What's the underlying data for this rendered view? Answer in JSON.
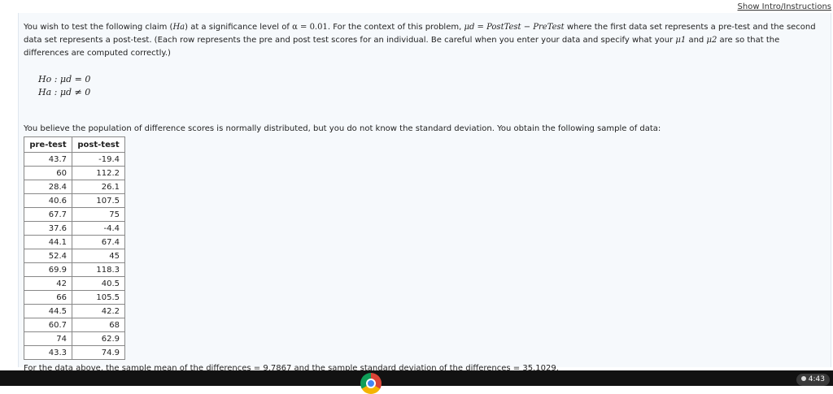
{
  "header": {
    "instructions_link": "Show Intro/Instructions"
  },
  "problem": {
    "sentence1_a": "You wish to test the following claim (",
    "sentence1_ha": "Ha",
    "sentence1_b": ") at a significance level of",
    "alpha_expr": "α = 0.01",
    "sentence1_c": ". For the context of this problem,",
    "mud_expr": "μd = PostTest − PreTest",
    "sentence1_d": "where the first data set represents a pre-test and the second data set represents a post-test. (Each row represents the pre and post test scores for an individual. Be careful when you enter your data and specify what your",
    "mu1": "μ1",
    "and_word": "and",
    "mu2": "μ2",
    "sentence1_e": "are so that the differences are computed correctly.)"
  },
  "hypotheses": {
    "h0": "Ho : μd = 0",
    "ha": "Ha : μd ≠ 0"
  },
  "believe_text": "You believe the population of difference scores is normally distributed, but you do not know the standard deviation. You obtain the following sample of data:",
  "table": {
    "headers": [
      "pre-test",
      "post-test"
    ],
    "rows": [
      [
        "43.7",
        "-19.4"
      ],
      [
        "60",
        "112.2"
      ],
      [
        "28.4",
        "26.1"
      ],
      [
        "40.6",
        "107.5"
      ],
      [
        "67.7",
        "75"
      ],
      [
        "37.6",
        "-4.4"
      ],
      [
        "44.1",
        "67.4"
      ],
      [
        "52.4",
        "45"
      ],
      [
        "69.9",
        "118.3"
      ],
      [
        "42",
        "40.5"
      ],
      [
        "66",
        "105.5"
      ],
      [
        "44.5",
        "42.2"
      ],
      [
        "60.7",
        "68"
      ],
      [
        "74",
        "62.9"
      ],
      [
        "43.3",
        "74.9"
      ]
    ]
  },
  "summary_text": "For the data above, the sample mean of the differences = 9.7867 and the sample standard deviation of the differences = 35.1029.",
  "taskbar": {
    "time": "4:43"
  }
}
